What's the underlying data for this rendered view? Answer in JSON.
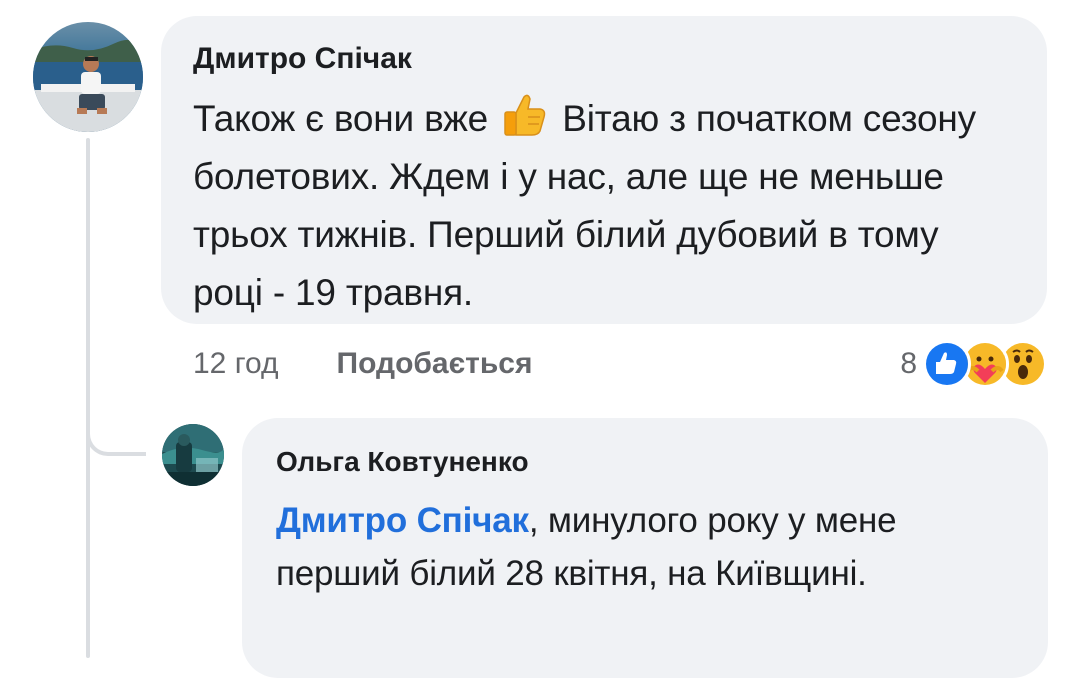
{
  "thread": {
    "comment": {
      "author": "Дмитро Спічак",
      "text_before_emoji": "Також є вони вже",
      "emoji": "thumbs-up",
      "text_after_emoji": "Вітаю з початком сезону болетових. Ждем і у нас, але ще не меньше трьох тижнів. Перший білий дубовий в тому році - 19 травня.",
      "timestamp": "12 год",
      "like_label": "Подобається",
      "reaction_count": "8",
      "reaction_icons": [
        "like-icon",
        "care-icon",
        "wow-icon"
      ]
    },
    "reply": {
      "author": "Ольга Ковтуненко",
      "mention": "Дмитро Спічак",
      "text": ", минулого року у мене перший білий 28 квітня, на Київщині."
    }
  },
  "colors": {
    "bubble": "#f0f2f5",
    "mention": "#216fdb",
    "meta_text": "#65676b",
    "like_blue": "#1877f2",
    "reaction_yellow": "#f7b928"
  }
}
